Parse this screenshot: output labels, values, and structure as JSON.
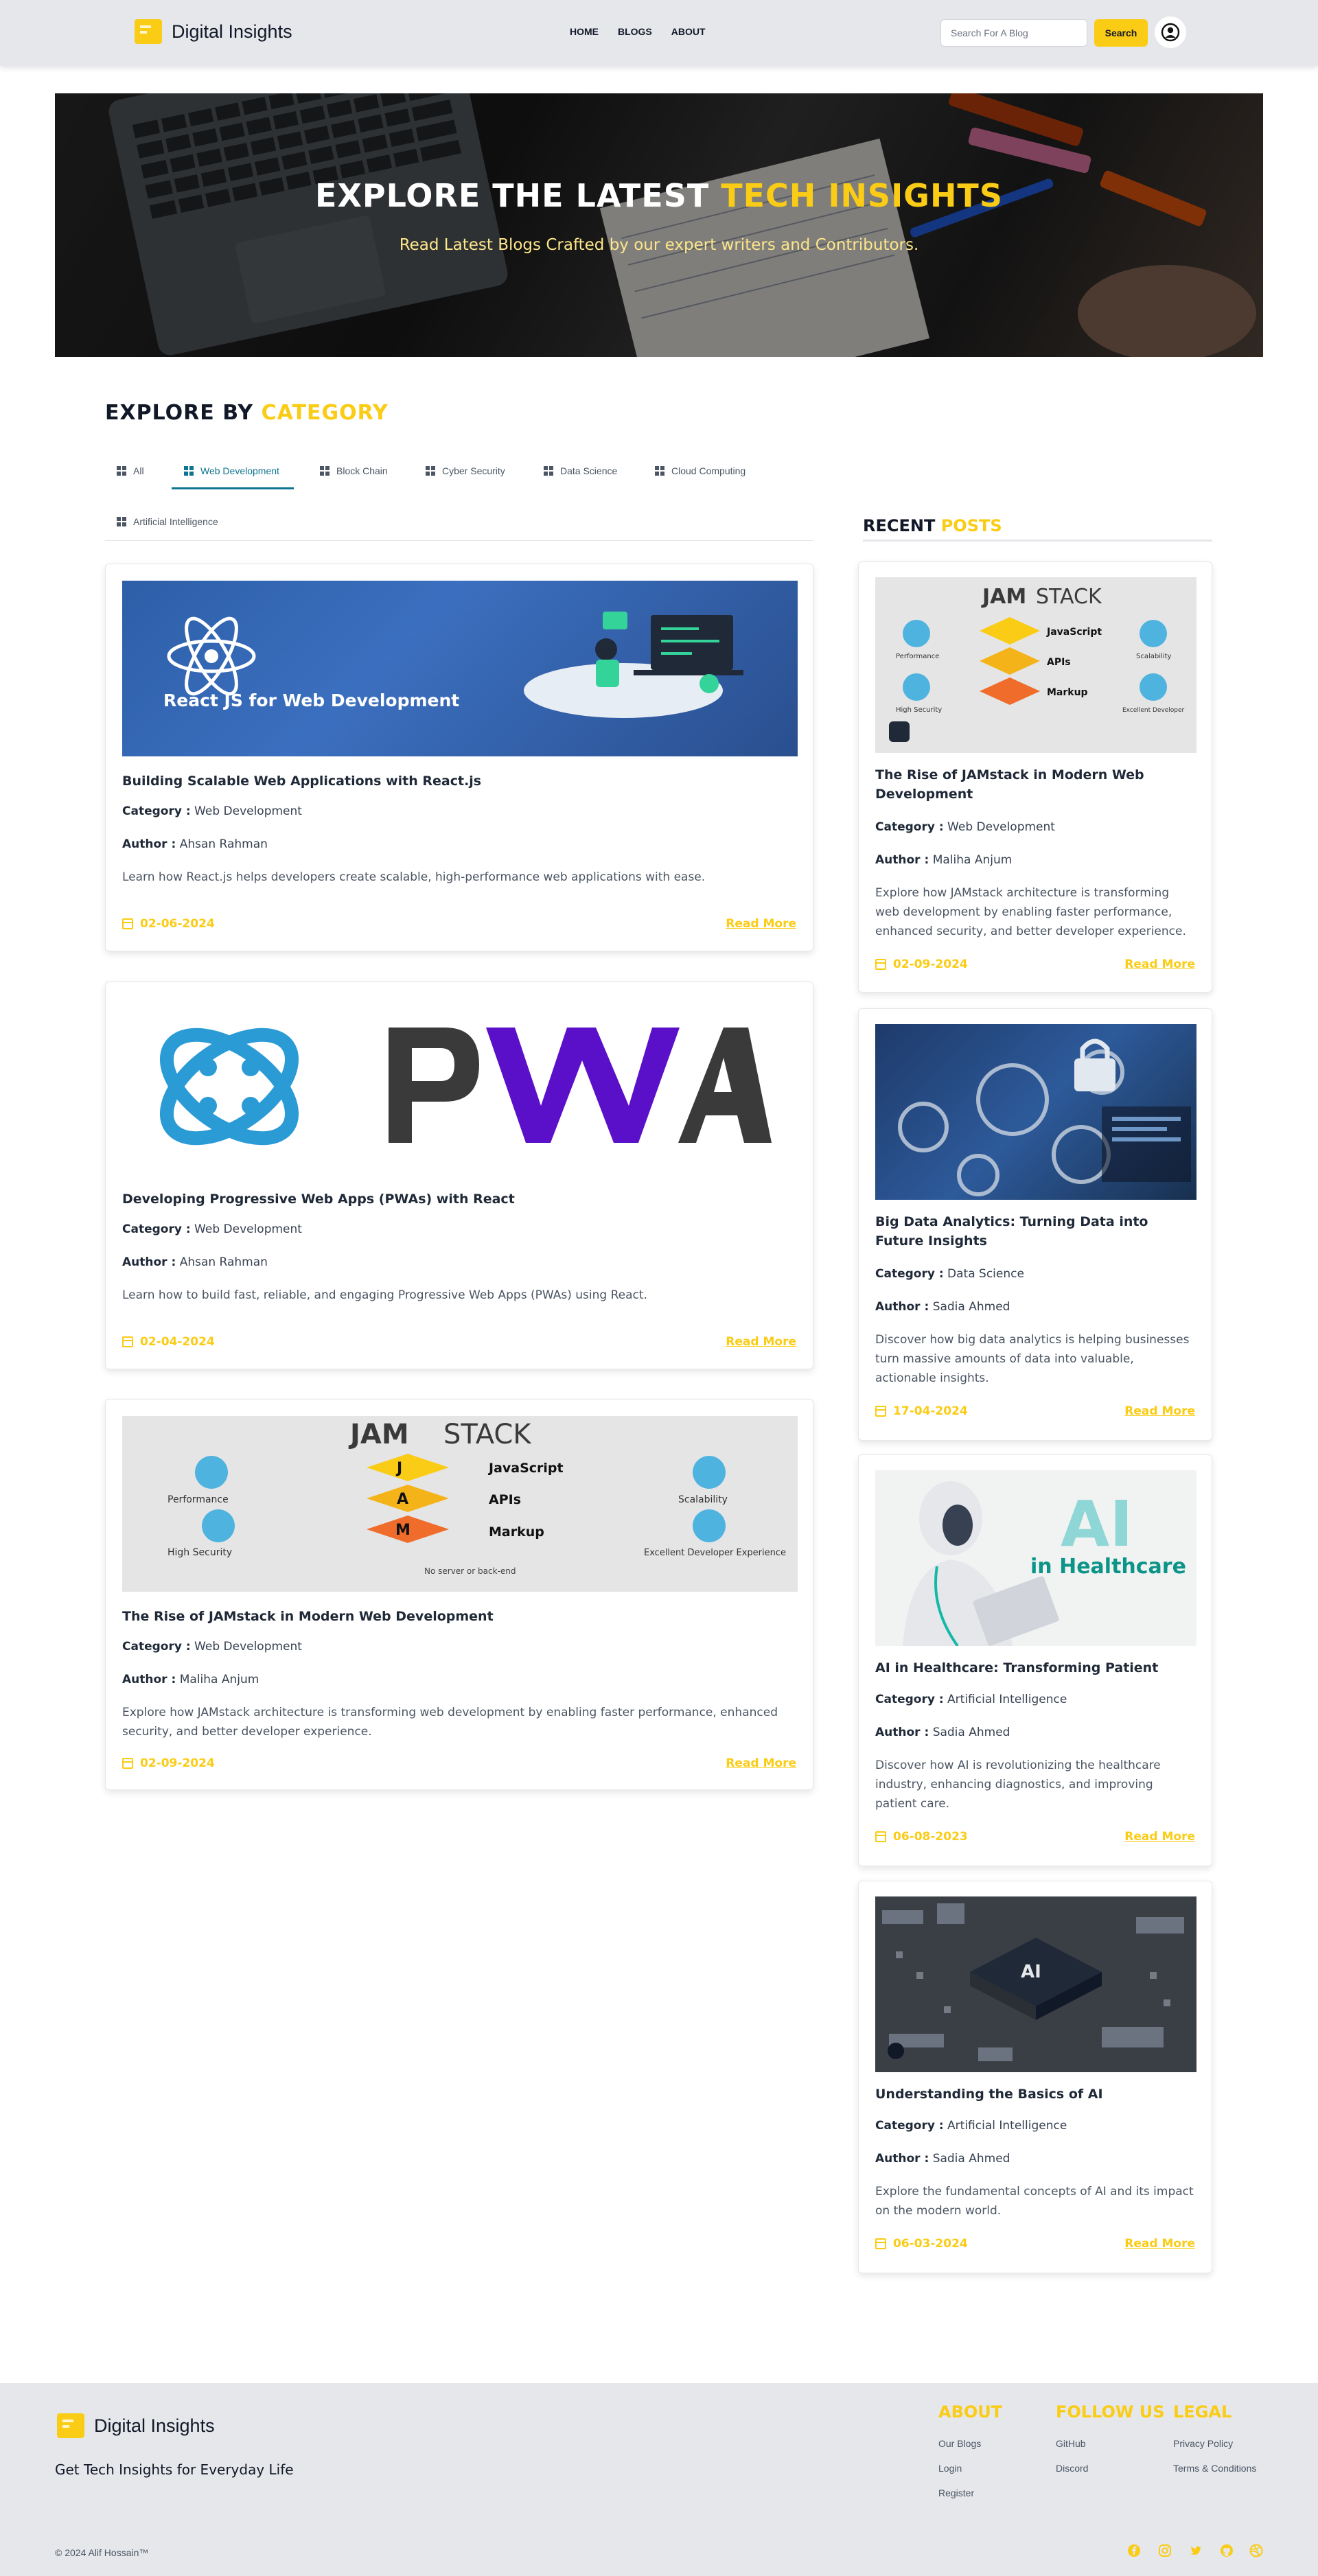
{
  "brand": {
    "name": "Digital Insights",
    "logo_color": "#facc15"
  },
  "nav": {
    "links": [
      "HOME",
      "BLOGS",
      "ABOUT"
    ],
    "search_placeholder": "Search For A Blog",
    "search_button": "Search",
    "avatar_icon": "user-circle-icon"
  },
  "hero": {
    "title_main": "EXPLORE THE LATEST ",
    "title_accent": "TECH INSIGHTS",
    "subtitle": "Read Latest Blogs Crafted by our expert writers and Contributors."
  },
  "category": {
    "title_main": "EXPLORE BY ",
    "title_accent": "CATEGORY",
    "tabs": [
      "All",
      "Web Development",
      "Block Chain",
      "Cyber Security",
      "Data Science",
      "Cloud Computing",
      "Artificial Intelligence"
    ],
    "active_tab": "Web Development"
  },
  "labels": {
    "category": "Category :",
    "author": "Author :",
    "read_more": "Read More"
  },
  "posts": [
    {
      "image": "React JS for Web Development",
      "title": "Building Scalable Web Applications with React.js",
      "category": "Web Development",
      "author": "Ahsan Rahman",
      "description": "Learn how React.js helps developers create scalable, high-performance web applications with ease.",
      "date": "02-06-2024"
    },
    {
      "image": "PWA",
      "title": "Developing Progressive Web Apps (PWAs) with React",
      "category": "Web Development",
      "author": "Ahsan Rahman",
      "description": "Learn how to build fast, reliable, and engaging Progressive Web Apps (PWAs) using React.",
      "date": "02-04-2024"
    },
    {
      "image": "JAMSTACK",
      "title": "The Rise of JAMstack in Modern Web Development",
      "category": "Web Development",
      "author": "Maliha Anjum",
      "description": "Explore how JAMstack architecture is transforming web development by enabling faster performance, enhanced security, and better developer experience.",
      "date": "02-09-2024"
    }
  ],
  "recent": {
    "title_main": "RECENT ",
    "title_accent": "POSTS",
    "posts": [
      {
        "image": "JAMSTACK",
        "title": "The Rise of JAMstack in Modern Web Development",
        "category": "Web Development",
        "author": "Maliha Anjum",
        "description": "Explore how JAMstack architecture is transforming web development by enabling faster performance, enhanced security, and better developer experience.",
        "date": "02-09-2024"
      },
      {
        "image": "big-data",
        "title": "Big Data Analytics: Turning Data into Future Insights",
        "category": "Data Science",
        "author": "Sadia Ahmed",
        "description": "Discover how big data analytics is helping businesses turn massive amounts of data into valuable, actionable insights.",
        "date": "17-04-2024"
      },
      {
        "image": "AI in Healthcare",
        "title": "AI in Healthcare: Transforming Patient",
        "category": "Artificial Intelligence",
        "author": "Sadia Ahmed",
        "description": "Discover how AI is revolutionizing the healthcare industry, enhancing diagnostics, and improving patient care.",
        "date": "06-08-2023"
      },
      {
        "image": "AI chip",
        "title": "Understanding the Basics of AI",
        "category": "Artificial Intelligence",
        "author": "Sadia Ahmed",
        "description": "Explore the fundamental concepts of AI and its impact on the modern world.",
        "date": "06-03-2024"
      }
    ]
  },
  "jamstack_img": {
    "title_a": "JAM",
    "title_b": "STACK",
    "items": [
      "JavaScript",
      "APIs",
      "Markup"
    ],
    "left": [
      "Performance",
      "High Security"
    ],
    "right": [
      "Scalability",
      "Excellent Developer Experience"
    ],
    "footer": "No server or back-end"
  },
  "healthcare_img": {
    "big": "AI",
    "small": "in Healthcare"
  },
  "footer": {
    "brand": "Digital Insights",
    "tagline": "Get Tech Insights for Everyday Life",
    "about_title": "ABOUT",
    "about_links": [
      "Our Blogs",
      "Login",
      "Register"
    ],
    "follow_title": "FOLLOW US",
    "follow_links": [
      "GitHub",
      "Discord"
    ],
    "legal_title": "LEGAL",
    "legal_links": [
      "Privacy Policy",
      "Terms & Conditions"
    ],
    "copyright": "© 2024 Alif Hossain™",
    "social_icons": [
      "facebook-icon",
      "instagram-icon",
      "twitter-icon",
      "github-icon",
      "dribbble-icon"
    ]
  }
}
